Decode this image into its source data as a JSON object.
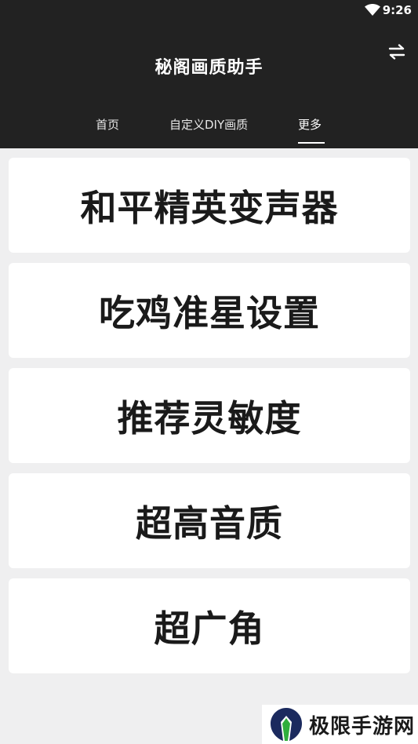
{
  "status_bar": {
    "time": "9:26",
    "wifi_icon": "wifi-icon"
  },
  "toolbar": {
    "title": "秘阁画质助手",
    "swap_icon": "swap-arrows-icon"
  },
  "tabs": [
    {
      "label": "首页",
      "active": false
    },
    {
      "label": "自定义DIY画质",
      "active": false
    },
    {
      "label": "更多",
      "active": true
    }
  ],
  "menu": [
    {
      "label": "和平精英变声器"
    },
    {
      "label": "吃鸡准星设置"
    },
    {
      "label": "推荐灵敏度"
    },
    {
      "label": "超高音质"
    },
    {
      "label": "超广角"
    }
  ],
  "watermark": {
    "text": "极限手游网"
  },
  "colors": {
    "header_bg": "#222222",
    "page_bg": "#efeff0",
    "card_bg": "#ffffff",
    "text_dark": "#1a1a1a"
  }
}
